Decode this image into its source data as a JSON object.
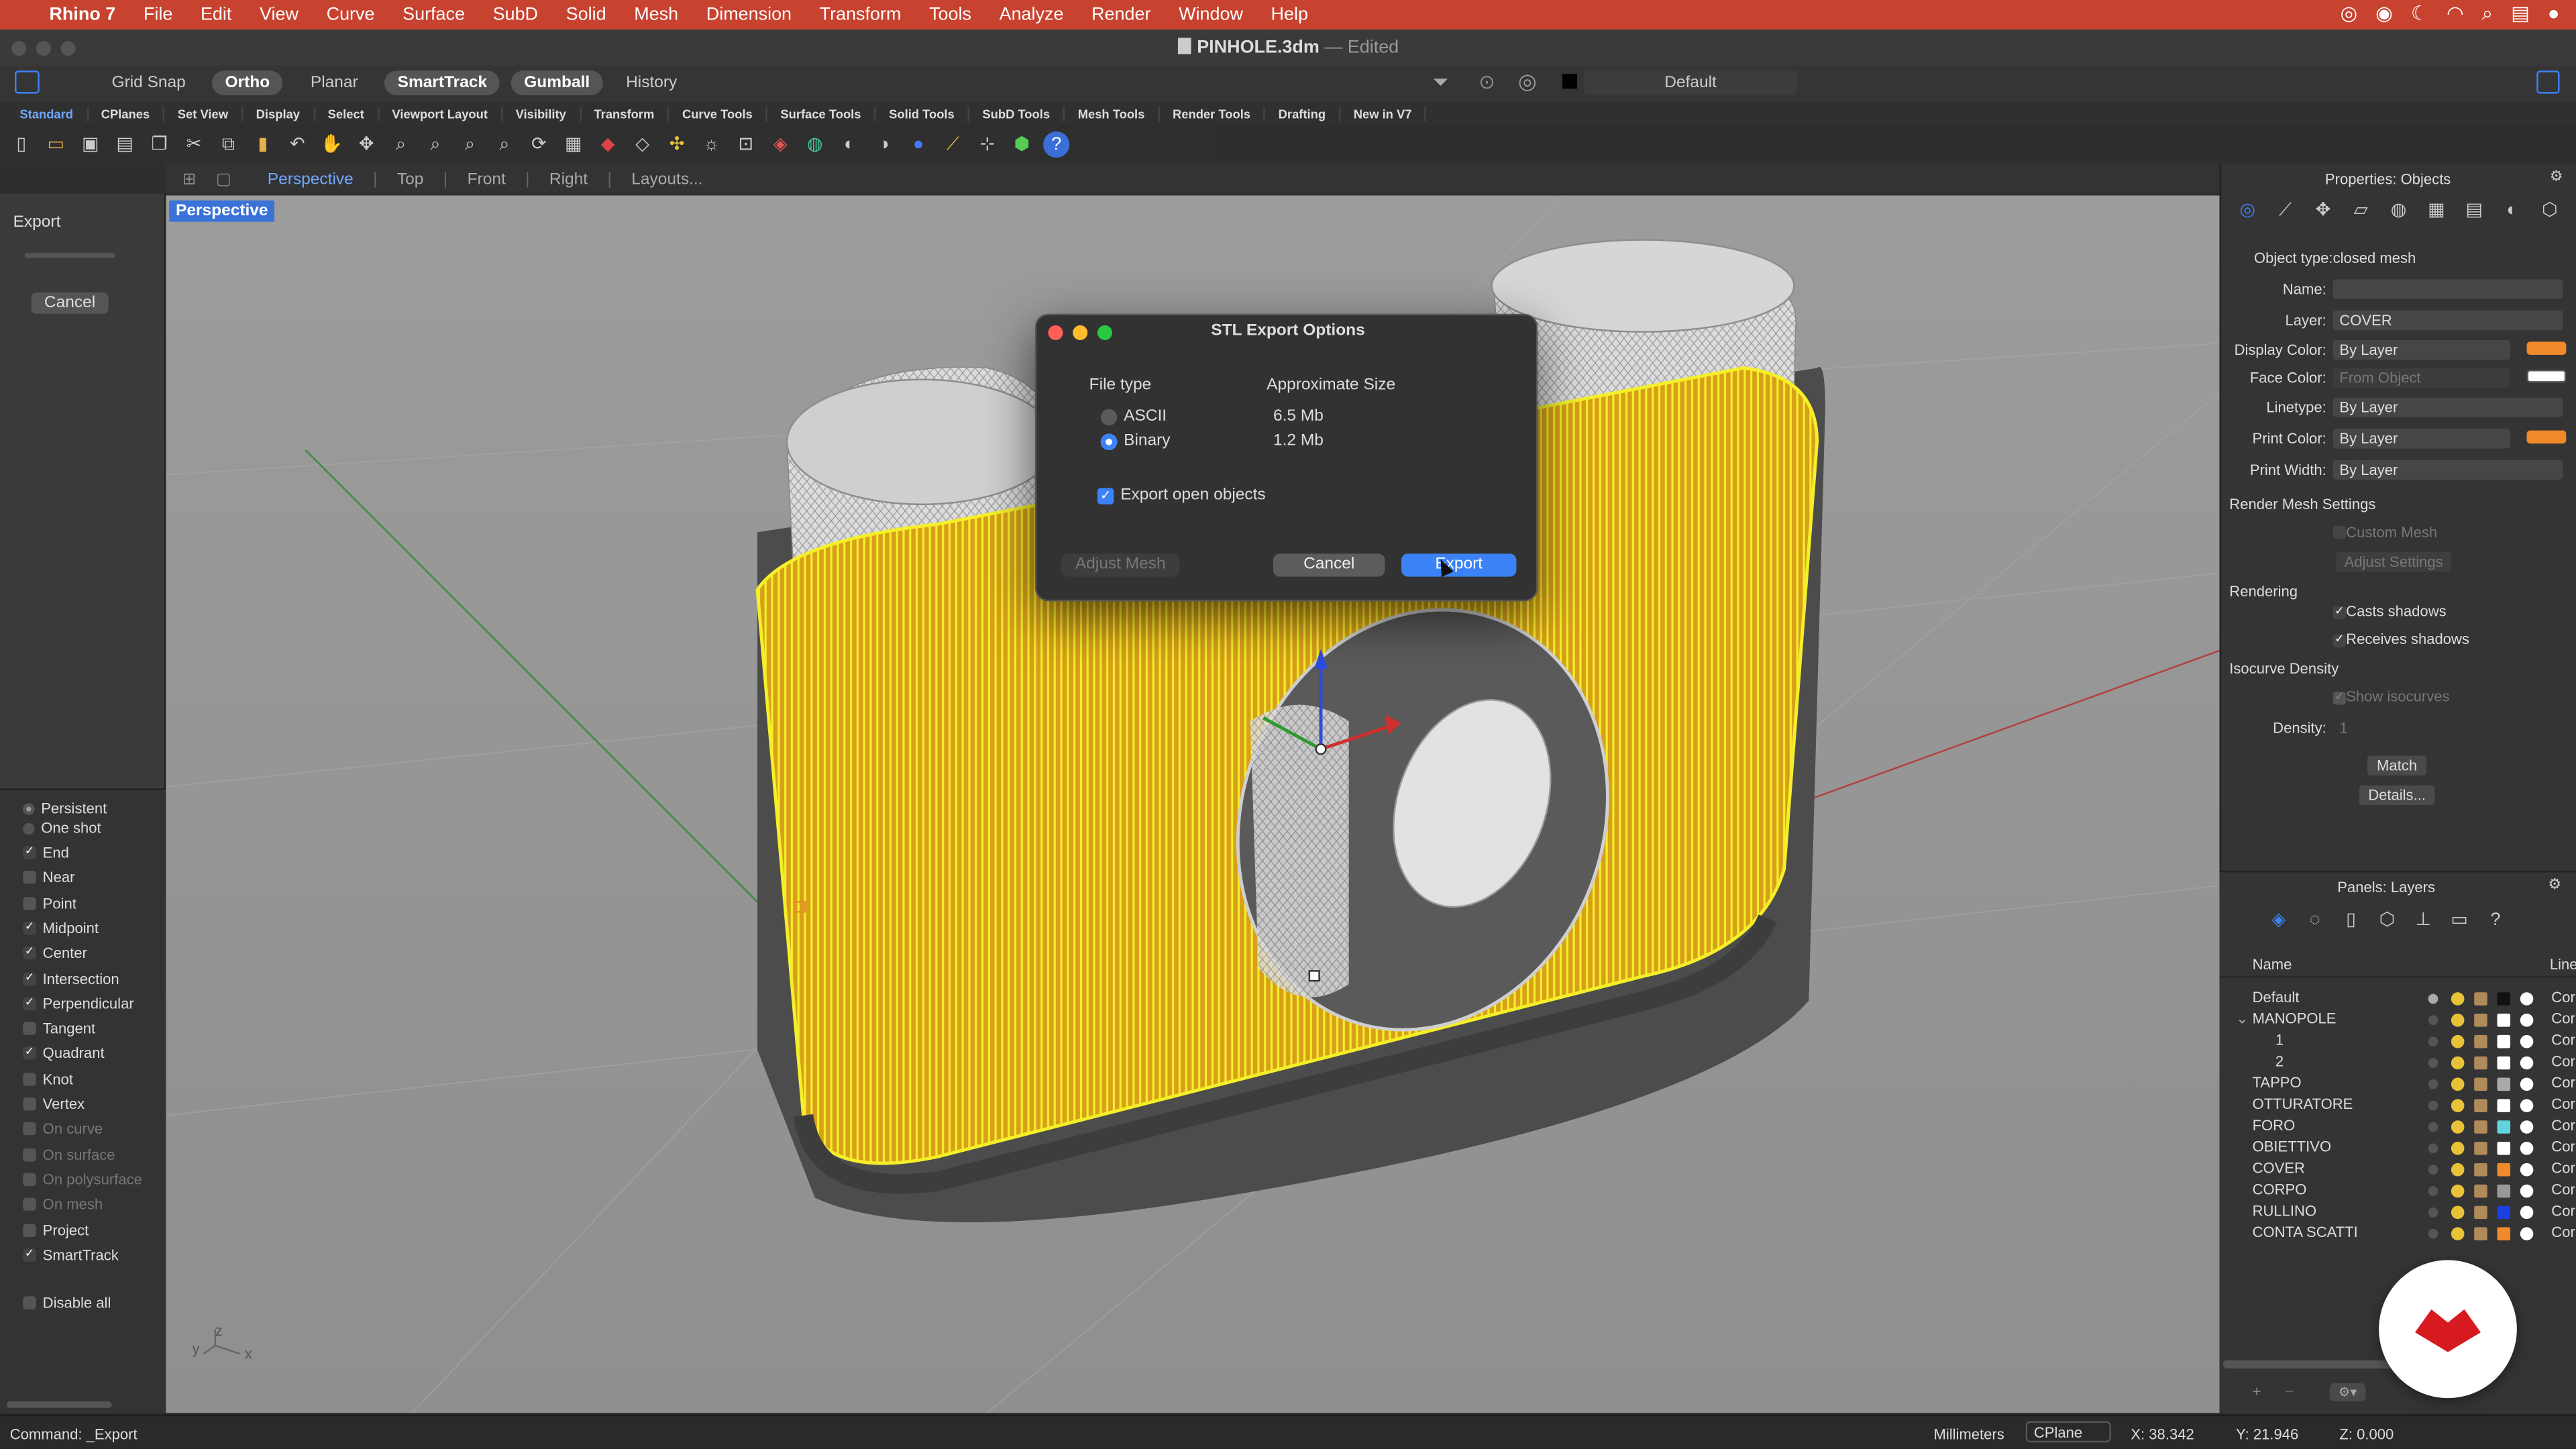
{
  "menubar": {
    "app": "Rhino 7",
    "items": [
      "File",
      "Edit",
      "View",
      "Curve",
      "Surface",
      "SubD",
      "Solid",
      "Mesh",
      "Dimension",
      "Transform",
      "Tools",
      "Analyze",
      "Render",
      "Window",
      "Help"
    ]
  },
  "window": {
    "title": "PINHOLE.3dm",
    "edited": "— Edited"
  },
  "toolbar": {
    "grid_snap": "Grid Snap",
    "ortho": "Ortho",
    "planar": "Planar",
    "smarttrack": "SmartTrack",
    "gumball": "Gumball",
    "history": "History",
    "layer_default": "Default"
  },
  "tabs": [
    "Standard",
    "CPlanes",
    "Set View",
    "Display",
    "Select",
    "Viewport Layout",
    "Visibility",
    "Transform",
    "Curve Tools",
    "Surface Tools",
    "Solid Tools",
    "SubD Tools",
    "Mesh Tools",
    "Render Tools",
    "Drafting",
    "New in V7"
  ],
  "viewport_tabs": [
    "Perspective",
    "Top",
    "Front",
    "Right",
    "Layouts..."
  ],
  "viewport": {
    "label": "Perspective",
    "axis_x": "x",
    "axis_y": "y",
    "axis_z": "z"
  },
  "left_panel": {
    "title": "Export",
    "cancel": "Cancel"
  },
  "osnap": {
    "persistent": "Persistent",
    "one_shot": "One shot",
    "items": [
      {
        "label": "End",
        "checked": true,
        "dim": false
      },
      {
        "label": "Near",
        "checked": false,
        "dim": false
      },
      {
        "label": "Point",
        "checked": false,
        "dim": false
      },
      {
        "label": "Midpoint",
        "checked": true,
        "dim": false
      },
      {
        "label": "Center",
        "checked": true,
        "dim": false
      },
      {
        "label": "Intersection",
        "checked": true,
        "dim": false
      },
      {
        "label": "Perpendicular",
        "checked": true,
        "dim": false
      },
      {
        "label": "Tangent",
        "checked": false,
        "dim": false
      },
      {
        "label": "Quadrant",
        "checked": true,
        "dim": false
      },
      {
        "label": "Knot",
        "checked": false,
        "dim": false
      },
      {
        "label": "Vertex",
        "checked": false,
        "dim": false
      },
      {
        "label": "On curve",
        "checked": false,
        "dim": true
      },
      {
        "label": "On surface",
        "checked": false,
        "dim": true
      },
      {
        "label": "On polysurface",
        "checked": false,
        "dim": true
      },
      {
        "label": "On mesh",
        "checked": false,
        "dim": true
      },
      {
        "label": "Project",
        "checked": false,
        "dim": false
      },
      {
        "label": "SmartTrack",
        "checked": true,
        "dim": false
      }
    ],
    "disable_all": "Disable all"
  },
  "dialog": {
    "title": "STL Export Options",
    "file_type": "File type",
    "approx_size": "Approximate Size",
    "ascii": "ASCII",
    "ascii_size": "6.5 Mb",
    "binary": "Binary",
    "binary_size": "1.2 Mb",
    "export_open": "Export open objects",
    "adjust_mesh": "Adjust Mesh",
    "cancel": "Cancel",
    "export": "Export"
  },
  "properties": {
    "header": "Properties: Objects",
    "object_type_label": "Object type:",
    "object_type": "closed mesh",
    "name_label": "Name:",
    "name": "",
    "layer_label": "Layer:",
    "layer": "COVER",
    "display_color_label": "Display Color:",
    "display_color": "By Layer",
    "face_color_label": "Face Color:",
    "face_color": "From Object",
    "linetype_label": "Linetype:",
    "linetype": "By Layer",
    "print_color_label": "Print Color:",
    "print_color": "By Layer",
    "print_width_label": "Print Width:",
    "print_width": "By Layer",
    "render_mesh": "Render Mesh Settings",
    "custom_mesh": "Custom Mesh",
    "adjust_settings": "Adjust Settings",
    "rendering": "Rendering",
    "casts_shadows": "Casts shadows",
    "receives_shadows": "Receives shadows",
    "isocurve_density": "Isocurve Density",
    "show_isocurves": "Show isocurves",
    "density_label": "Density:",
    "density": "1",
    "match": "Match",
    "details": "Details..."
  },
  "layers": {
    "header": "Panels: Layers",
    "col_name": "Name",
    "col_line": "Line",
    "rows": [
      {
        "name": "Default",
        "indent": 0,
        "color": "#111111",
        "suffix": "Cor"
      },
      {
        "name": "MANOPOLE",
        "indent": 0,
        "color": "#ffffff",
        "suffix": "Cor"
      },
      {
        "name": "1",
        "indent": 1,
        "color": "#ffffff",
        "suffix": "Cor"
      },
      {
        "name": "2",
        "indent": 1,
        "color": "#ffffff",
        "suffix": "Cor"
      },
      {
        "name": "TAPPO",
        "indent": 0,
        "color": "#aaaaaa",
        "suffix": "Cor"
      },
      {
        "name": "OTTURATORE",
        "indent": 0,
        "color": "#ffffff",
        "suffix": "Cor"
      },
      {
        "name": "FORO",
        "indent": 0,
        "color": "#5fd3e0",
        "suffix": "Cor"
      },
      {
        "name": "OBIETTIVO",
        "indent": 0,
        "color": "#ffffff",
        "suffix": "Cor"
      },
      {
        "name": "COVER",
        "indent": 0,
        "color": "#f0892a",
        "suffix": "Cor"
      },
      {
        "name": "CORPO",
        "indent": 0,
        "color": "#999999",
        "suffix": "Cor"
      },
      {
        "name": "RULLINO",
        "indent": 0,
        "color": "#1b3fe0",
        "suffix": "Cor"
      },
      {
        "name": "CONTA SCATTI",
        "indent": 0,
        "color": "#f0892a",
        "suffix": "Cor"
      }
    ]
  },
  "status": {
    "command": "Command: _Export",
    "units": "Millimeters",
    "cplane": "CPlane",
    "x": "X: 38.342",
    "y": "Y: 21.946",
    "z": "Z: 0.000"
  },
  "colors": {
    "menubar": "#c7422f",
    "accent": "#3b82f6",
    "mesh_yellow": "#f2ec1c",
    "orange": "#f0892a"
  }
}
